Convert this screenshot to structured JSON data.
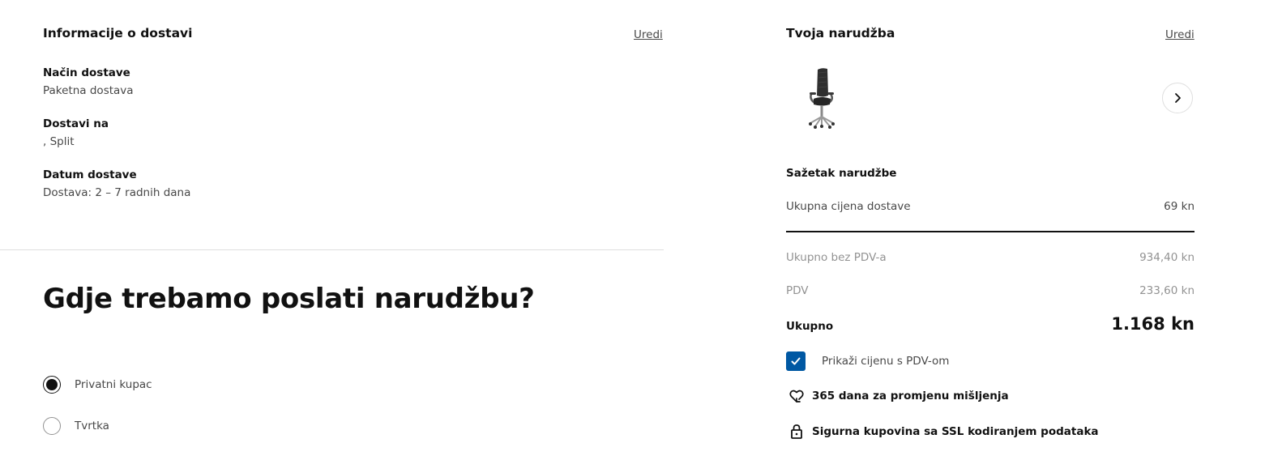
{
  "delivery_info": {
    "title": "Informacije o dostavi",
    "edit_label": "Uredi",
    "method_label": "Način dostave",
    "method_value": "Paketna dostava",
    "deliver_to_label": "Dostavi na",
    "deliver_to_value": ", Split",
    "date_label": "Datum dostave",
    "date_value": "Dostava: 2 – 7 radnih dana"
  },
  "shipping_question": {
    "heading": "Gdje trebamo poslati narudžbu?",
    "options": [
      {
        "label": "Privatni kupac",
        "selected": true
      },
      {
        "label": "Tvrtka",
        "selected": false
      }
    ]
  },
  "order": {
    "title": "Tvoja narudžba",
    "edit_label": "Uredi",
    "product_image": "office-chair-image",
    "next_icon": "chevron-right-icon"
  },
  "summary": {
    "title": "Sažetak narudžbe",
    "delivery_price_label": "Ukupna cijena dostave",
    "delivery_price_value": "69 kn",
    "subtotal_label": "Ukupno bez PDV-a",
    "subtotal_value": "934,40 kn",
    "vat_label": "PDV",
    "vat_value": "233,60 kn",
    "total_label": "Ukupno",
    "total_value": "1.168 kn",
    "vat_checkbox_label": "Prikaži cijenu s PDV-om",
    "vat_checkbox_checked": true
  },
  "features": {
    "return_policy": "365 dana za promjenu mišljenja",
    "return_icon": "heart-return-icon",
    "secure_purchase": "Sigurna kupovina sa SSL kodiranjem podataka",
    "secure_icon": "lock-icon"
  },
  "colors": {
    "accent_blue": "#0058a3",
    "text_primary": "#111111",
    "text_secondary": "#484848",
    "text_muted": "#929292",
    "divider": "#dfdfdf"
  }
}
